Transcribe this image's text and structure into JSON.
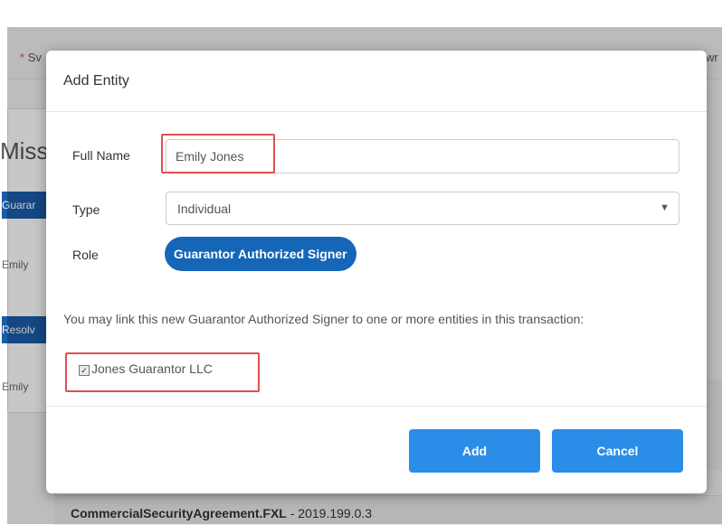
{
  "background": {
    "required_fragment": "Sv",
    "required_star": "*",
    "right_fragment": "wr",
    "heading_fragment": "Missi",
    "blue_bar_1": "Guarar",
    "row_1": "Emily",
    "blue_bar_2": "Resolv",
    "row_2": "Emily",
    "footer_doc_name": "CommercialSecurityAgreement.FXL",
    "footer_doc_version": " - 2019.199.0.3"
  },
  "modal": {
    "title": "Add Entity",
    "full_name_label": "Full Name",
    "full_name_value": "Emily Jones",
    "type_label": "Type",
    "type_selected": "Individual",
    "role_label": "Role",
    "role_value": "Guarantor Authorized Signer",
    "link_text": "You may link this new Guarantor Authorized Signer to one or more entities in this transaction:",
    "linked_entity": {
      "label": "Jones Guarantor LLC",
      "checked": true
    },
    "add_label": "Add",
    "cancel_label": "Cancel"
  },
  "colors": {
    "primary_button": "#2a8de8",
    "role_badge": "#1666b8",
    "highlight": "#e05050"
  }
}
